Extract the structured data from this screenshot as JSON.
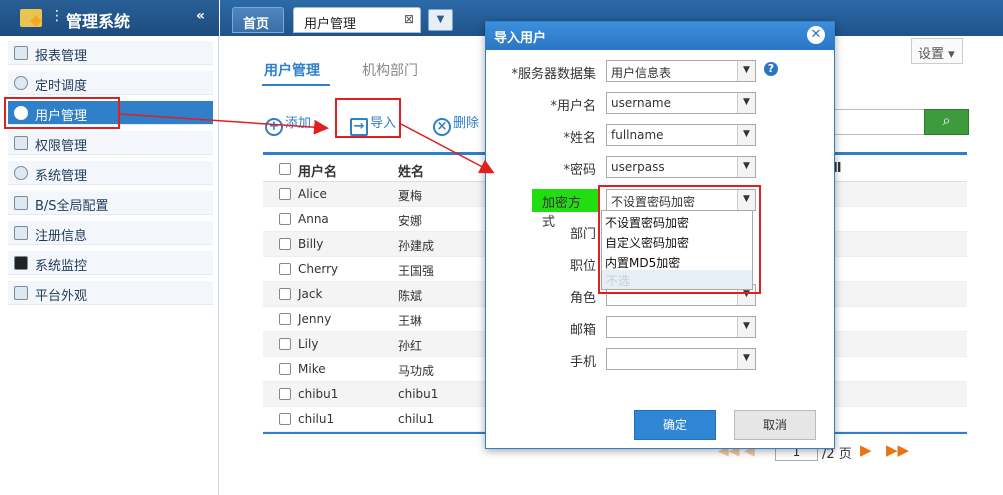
{
  "app_title": "管理系统",
  "collapse_icon": "«",
  "sidebar": {
    "items": [
      {
        "label": "报表管理",
        "icon": "report-icon"
      },
      {
        "label": "定时调度",
        "icon": "clock-icon"
      },
      {
        "label": "用户管理",
        "icon": "user-icon",
        "active": true
      },
      {
        "label": "权限管理",
        "icon": "permission-icon"
      },
      {
        "label": "系统管理",
        "icon": "gear-icon"
      },
      {
        "label": "B/S全局配置",
        "icon": "config-icon"
      },
      {
        "label": "注册信息",
        "icon": "register-icon"
      },
      {
        "label": "系统监控",
        "icon": "monitor-icon"
      },
      {
        "label": "平台外观",
        "icon": "appearance-icon"
      }
    ]
  },
  "tabs": {
    "home": "首页",
    "user": "用户管理",
    "close": "⊠",
    "more": "▼"
  },
  "subtabs": {
    "users": "用户管理",
    "orgs": "机构部门"
  },
  "settings_label": "设置 ▾",
  "toolbar": {
    "add": "添加",
    "import": "导入",
    "delete": "删除",
    "add_icon": "+",
    "import_icon": "→",
    "delete_icon": "×"
  },
  "search_icon": "⌕",
  "table": {
    "headers": {
      "username": "用户名",
      "fullname": "姓名",
      "col3": "Ⅱ"
    },
    "rows": [
      {
        "username": "Alice",
        "fullname": "夏梅"
      },
      {
        "username": "Anna",
        "fullname": "安娜"
      },
      {
        "username": "Billy",
        "fullname": "孙建成"
      },
      {
        "username": "Cherry",
        "fullname": "王国强"
      },
      {
        "username": "Jack",
        "fullname": "陈斌"
      },
      {
        "username": "Jenny",
        "fullname": "王琳"
      },
      {
        "username": "Lily",
        "fullname": "孙红"
      },
      {
        "username": "Mike",
        "fullname": "马功成"
      },
      {
        "username": "chibu1",
        "fullname": "chibu1"
      },
      {
        "username": "chilu1",
        "fullname": "chilu1"
      }
    ]
  },
  "pager": {
    "prev": "◀◀ ◀",
    "page": "1",
    "total_text": "/2 页",
    "next": "▶",
    "last": "▶▶"
  },
  "dialog": {
    "title": "导入用户",
    "close": "✕",
    "fields": {
      "dataset": {
        "label": "*服务器数据集",
        "value": "用户信息表"
      },
      "username": {
        "label": "*用户名",
        "value": "username"
      },
      "fullname": {
        "label": "*姓名",
        "value": "fullname"
      },
      "password": {
        "label": "*密码",
        "value": "userpass"
      },
      "encrypt": {
        "label": "加密方式",
        "value": "不设置密码加密"
      },
      "dept": {
        "label": "部门",
        "value": ""
      },
      "position": {
        "label": "职位",
        "value": ""
      },
      "role": {
        "label": "角色",
        "value": ""
      },
      "email": {
        "label": "邮箱",
        "value": ""
      },
      "phone": {
        "label": "手机",
        "value": ""
      }
    },
    "help": "?",
    "dropdown_options": [
      "不设置密码加密",
      "自定义密码加密",
      "内置MD5加密"
    ],
    "dropdown_disabled": "不选",
    "ok": "确定",
    "cancel": "取消"
  },
  "arrow_glyph": "▼",
  "colors": {
    "accent": "#2f7fc9",
    "highlight": "#e02020",
    "green": "#22dd11"
  }
}
